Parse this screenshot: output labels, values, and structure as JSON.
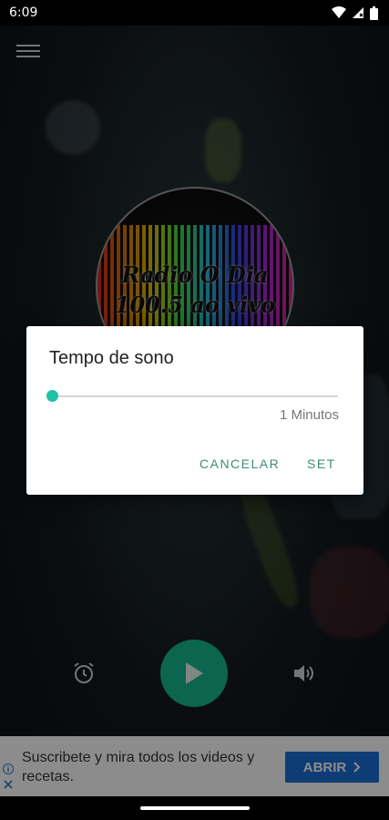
{
  "status_bar": {
    "time": "6:09"
  },
  "logo": {
    "line1": "Radio O Dia",
    "line2": "100.5 ao vivo"
  },
  "dialog": {
    "title": "Tempo de sono",
    "slider_value": "1 Minutos",
    "slider_fraction": 0.0,
    "cancel_label": "CANCELAR",
    "set_label": "SET"
  },
  "ad": {
    "text": "Suscribete y mira todos los videos y recetas.",
    "button_label": "ABRIR"
  },
  "colors": {
    "accent": "#1fc1a6",
    "play": "#17b890",
    "ad_button": "#1a6fd8"
  }
}
